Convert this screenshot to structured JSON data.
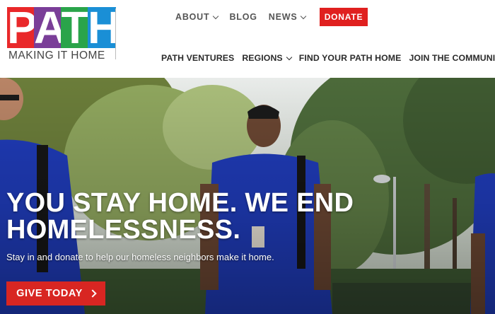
{
  "brand": {
    "logo_letters": [
      "P",
      "A",
      "T",
      "H"
    ],
    "logo_colors": [
      "#e9282a",
      "#7a3e98",
      "#2aa44a",
      "#1a8fd6"
    ],
    "tagline": "MAKING IT HOME"
  },
  "top_nav": {
    "about": "ABOUT",
    "blog": "BLOG",
    "news": "NEWS",
    "donate": "DONATE"
  },
  "main_nav": {
    "ventures": "PATH VENTURES",
    "regions": "REGIONS",
    "find_home": "FIND YOUR PATH HOME",
    "join": "JOIN THE COMMUNITY"
  },
  "hero": {
    "headline_line1": "YOU STAY HOME. WE END",
    "headline_line2": "HOMELESSNESS.",
    "subline": "Stay in and donate to help our homeless neighbors make it home.",
    "cta": "GIVE TODAY"
  },
  "colors": {
    "accent_red": "#e0201f",
    "uniform_blue": "#1f3bb8"
  }
}
